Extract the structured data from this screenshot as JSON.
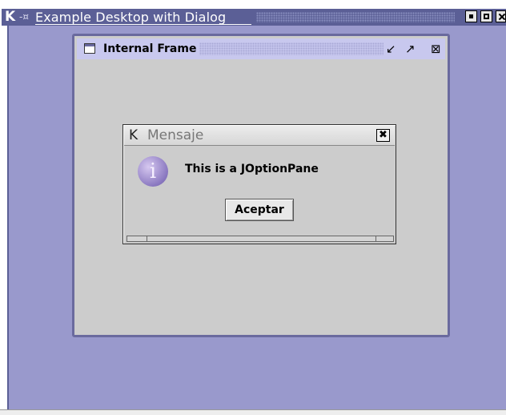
{
  "outer_window": {
    "title": "Example Desktop with Dialog",
    "k_glyph": "K",
    "pin_glyph": "-¤"
  },
  "internal_frame": {
    "title": "Internal Frame",
    "iconify_glyph": "↙",
    "maximize_glyph": "↗",
    "close_glyph": "⊠"
  },
  "dialog": {
    "title": "Mensaje",
    "k_glyph": "K",
    "close_glyph": "✖",
    "icon_glyph": "i",
    "message": "This is a JOptionPane",
    "ok_label": "Aceptar"
  },
  "colors": {
    "desktop": "#9999cc",
    "outer_titlebar": "#5b5f96",
    "frame_titlebar": "#c8c8ee"
  }
}
